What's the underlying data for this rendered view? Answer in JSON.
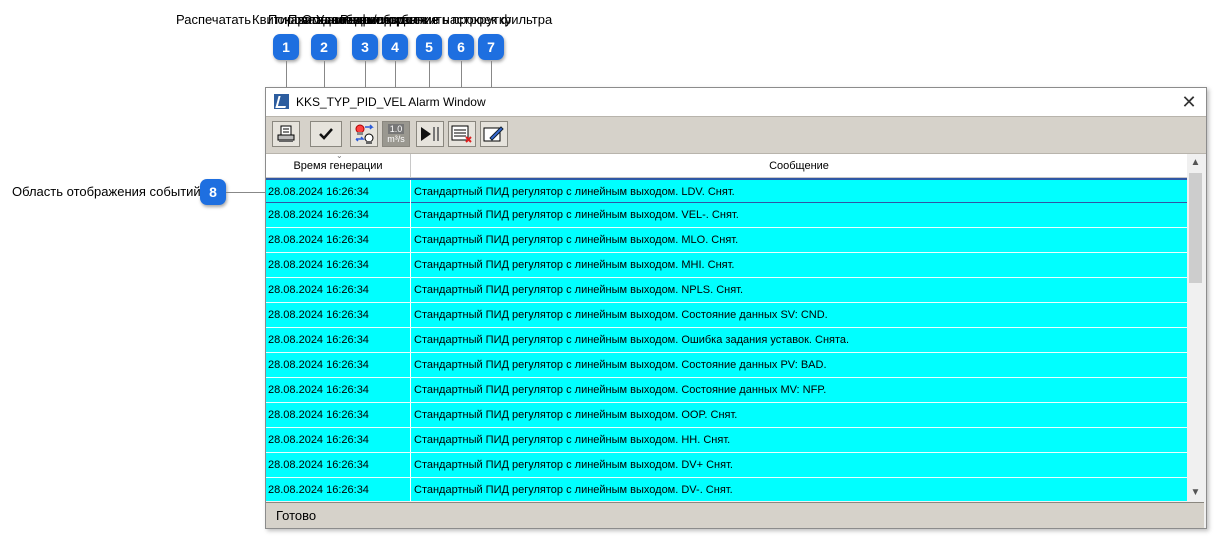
{
  "annotations": {
    "top_labels": [
      "Распечатать",
      "Квитировать событие",
      "Показать активные события",
      "Применить фильтр",
      "Остановить/продолжить прокрутку",
      "Удалить событие",
      "Редактирование настроек фильтра"
    ],
    "badges": [
      "1",
      "2",
      "3",
      "4",
      "5",
      "6",
      "7",
      "8"
    ],
    "side_label": "Область отображения событий"
  },
  "window": {
    "title": "KKS_TYP_PID_VEL Alarm Window",
    "close_glyph": "✕"
  },
  "toolbar": {
    "buttons": [
      {
        "name": "print-icon"
      },
      {
        "name": "checkmark-icon"
      },
      {
        "name": "active-events-icon"
      },
      {
        "name": "units-filter-icon",
        "top_text": "1.0",
        "bottom_text": "m³/s"
      },
      {
        "name": "play-pause-icon"
      },
      {
        "name": "delete-event-icon"
      },
      {
        "name": "edit-filter-icon"
      }
    ]
  },
  "table": {
    "columns": [
      "Время генерации",
      "Сообщение"
    ],
    "rows": [
      {
        "time": "28.08.2024 16:26:34",
        "message": "Стандартный ПИД регулятор с линейным выходом. LDV. Снят."
      },
      {
        "time": "28.08.2024 16:26:34",
        "message": "Стандартный ПИД регулятор с линейным выходом. VEL-. Снят."
      },
      {
        "time": "28.08.2024 16:26:34",
        "message": "Стандартный ПИД регулятор с линейным выходом. MLO. Снят."
      },
      {
        "time": "28.08.2024 16:26:34",
        "message": "Стандартный ПИД регулятор с линейным выходом. MHI. Снят."
      },
      {
        "time": "28.08.2024 16:26:34",
        "message": "Стандартный ПИД регулятор с линейным выходом. NPLS. Снят."
      },
      {
        "time": "28.08.2024 16:26:34",
        "message": "Стандартный ПИД регулятор с линейным выходом. Состояние данных SV: CND."
      },
      {
        "time": "28.08.2024 16:26:34",
        "message": "Стандартный ПИД регулятор с линейным выходом. Ошибка задания уставок. Снята."
      },
      {
        "time": "28.08.2024 16:26:34",
        "message": "Стандартный ПИД регулятор с линейным выходом. Состояние данных PV: BAD."
      },
      {
        "time": "28.08.2024 16:26:34",
        "message": "Стандартный ПИД регулятор с линейным выходом. Состояние данных MV: NFP."
      },
      {
        "time": "28.08.2024 16:26:34",
        "message": "Стандартный ПИД регулятор с линейным выходом. OOP. Снят."
      },
      {
        "time": "28.08.2024 16:26:34",
        "message": "Стандартный ПИД регулятор с линейным выходом. HH. Снят."
      },
      {
        "time": "28.08.2024 16:26:34",
        "message": "Стандартный ПИД регулятор с линейным выходом. DV+ Снят."
      },
      {
        "time": "28.08.2024 16:26:34",
        "message": "Стандартный ПИД регулятор с линейным выходом. DV-. Снят."
      }
    ],
    "row_color": "#00ffff",
    "selected_border_color": "#2f57a5"
  },
  "status_bar": {
    "text": "Готово"
  },
  "colors": {
    "badge": "#1e6fe0"
  }
}
